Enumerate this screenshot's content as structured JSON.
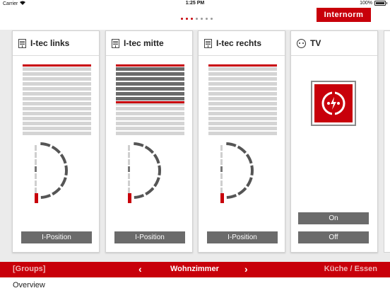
{
  "statusbar": {
    "carrier": "Carrier",
    "time": "1:25 PM",
    "battery": "100%"
  },
  "header": {
    "brand": "Internorm",
    "page_dots": 7,
    "active_dot": 2
  },
  "cards": [
    {
      "title": "I-tec links",
      "button": "I-Position",
      "closed_fraction": 0.0
    },
    {
      "title": "I-tec mitte",
      "button": "I-Position",
      "closed_fraction": 0.5
    },
    {
      "title": "I-tec rechts",
      "button": "I-Position",
      "closed_fraction": 0.0
    }
  ],
  "tv": {
    "title": "TV",
    "on_label": "On",
    "off_label": "Off"
  },
  "navbar": {
    "groups": "[Groups]",
    "prev": "‹",
    "room": "Wohnzimmer",
    "next": "›",
    "next_room": "Küche / Essen"
  },
  "footer": {
    "overview": "Overview"
  },
  "colors": {
    "accent": "#c8000a",
    "dark": "#6b6b6b",
    "light": "#d4d4d4"
  }
}
